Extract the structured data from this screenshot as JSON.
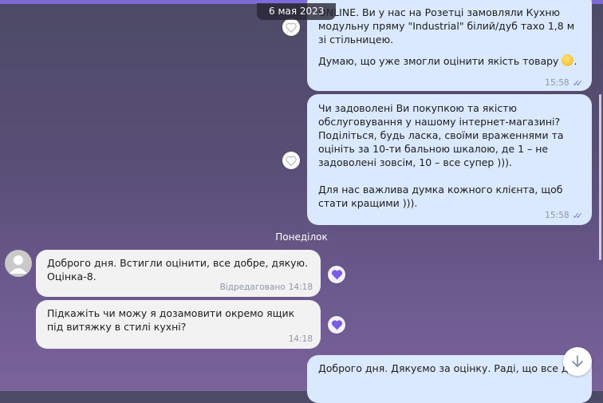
{
  "date_chip": "6 мая 2023",
  "day_separator": "Понеділок",
  "messages": [
    {
      "direction": "outgoing",
      "text": "ONLINE. Ви у нас на Розетці замовляли Кухню модульну пряму \"Industrial\" білий/дуб тахо 1,8 м зі стільницею.",
      "text2": "Думаю, що уже змогли оцінити якість товару",
      "emoji": "smile-emoji",
      "time": "15:58",
      "ticks": "✓✓"
    },
    {
      "direction": "outgoing",
      "text": "Чи задоволені Ви покупкою та якістю обслуговування у нашому інтернет-магазині?\nПоділіться, будь ласка, своїми враженнями та  оцініть за 10-ти бальною шкалою, де 1 – не задоволені зовсім, 10 – все супер ))).\n\nДля нас важлива думка кожного клієнта, щоб стати кращими ))).",
      "time": "15:58",
      "ticks": "✓✓"
    },
    {
      "direction": "incoming",
      "text": "Доброго дня. Встигли оцінити, все добре, дякую. Оцінка-8.",
      "edited_label": "Відредаговано",
      "time": "14:18"
    },
    {
      "direction": "incoming",
      "text": "Підкажіть чи можу я дозамовити окремо ящик під витяжку в стилі кухні?",
      "time": "14:18"
    },
    {
      "direction": "outgoing",
      "text": "Доброго дня. Дякуємо за оцінку. Раді, що все добре"
    }
  ],
  "icons": {
    "heart": "heart-icon",
    "avatar": "user-avatar-icon",
    "scroll_down": "arrow-down-icon"
  },
  "colors": {
    "outgoing_bubble": "#dbe9ff",
    "incoming_bubble": "#f2f2f2",
    "accent": "#7f6bd8",
    "heart_filled": "#7b5ce6"
  }
}
